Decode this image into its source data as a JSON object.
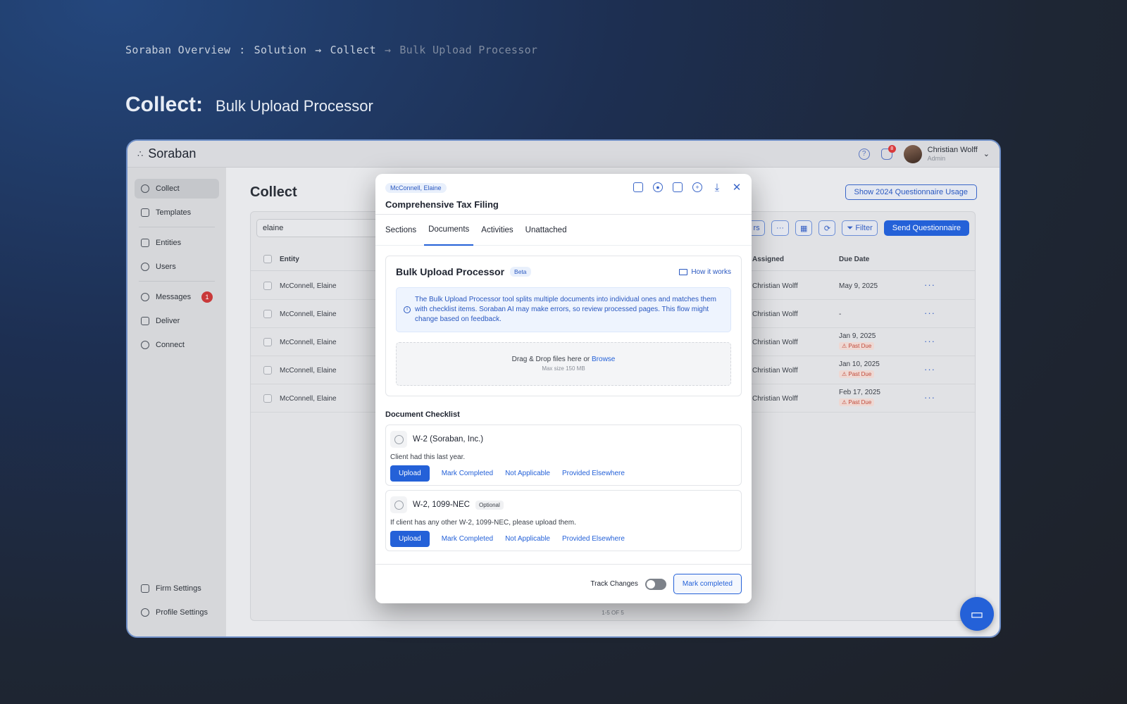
{
  "breadcrumb": {
    "items": [
      "Soraban Overview",
      ":",
      "Solution",
      "→",
      "Collect",
      "→",
      "Bulk Upload Processor"
    ]
  },
  "headline": {
    "section": "Collect:",
    "title": "Bulk Upload Processor"
  },
  "app": {
    "logo": "Soraban",
    "user": {
      "name": "Christian Wolff",
      "role": "Admin",
      "notifications": "8"
    },
    "sidebar": {
      "items": [
        {
          "label": "Collect",
          "icon": "collect-icon"
        },
        {
          "label": "Templates",
          "icon": "file-icon"
        },
        {
          "label": "Entities",
          "icon": "building-icon"
        },
        {
          "label": "Users",
          "icon": "users-icon"
        },
        {
          "label": "Messages",
          "icon": "chat-icon",
          "badge": "1"
        },
        {
          "label": "Deliver",
          "icon": "deliver-icon"
        },
        {
          "label": "Connect",
          "icon": "link-icon"
        }
      ],
      "bottom": [
        {
          "label": "Firm Settings",
          "icon": "building-icon"
        },
        {
          "label": "Profile Settings",
          "icon": "profile-gear-icon"
        }
      ]
    },
    "main": {
      "title": "Collect",
      "questionnaire_usage_btn": "Show 2024 Questionnaire Usage",
      "search_value": "elaine",
      "toolbar": {
        "partial": "rs",
        "more": "···",
        "filter": "Filter",
        "send": "Send Questionnaire"
      },
      "columns": [
        "Entity",
        "Assigned",
        "Due Date"
      ],
      "rows": [
        {
          "entity": "McConnell, Elaine",
          "assigned": "Christian Wolff",
          "due": "May 9, 2025",
          "past_due": ""
        },
        {
          "entity": "McConnell, Elaine",
          "assigned": "Christian Wolff",
          "due": "-",
          "past_due": ""
        },
        {
          "entity": "McConnell, Elaine",
          "assigned": "Christian Wolff",
          "due": "Jan 9, 2025",
          "past_due": "⚠ Past Due"
        },
        {
          "entity": "McConnell, Elaine",
          "assigned": "Christian Wolff",
          "due": "Jan 10, 2025",
          "past_due": "⚠ Past Due"
        },
        {
          "entity": "McConnell, Elaine",
          "assigned": "Christian Wolff",
          "due": "Feb 17, 2025",
          "past_due": "⚠ Past Due"
        }
      ],
      "pager": "1-5 OF 5"
    }
  },
  "modal": {
    "client_chip": "McConnell, Elaine",
    "title": "Comprehensive Tax Filing",
    "tabs": [
      "Sections",
      "Documents",
      "Activities",
      "Unattached"
    ],
    "active_tab": "Documents",
    "bulk": {
      "title": "Bulk Upload Processor",
      "beta": "Beta",
      "how": "How it works",
      "info": "The Bulk Upload Processor tool splits multiple documents into individual ones and matches them with checklist items. Soraban AI may make errors, so review processed pages. This flow might change based on feedback.",
      "drop_text": "Drag & Drop files here or",
      "browse": "Browse",
      "max_size": "Max size 150 MB"
    },
    "checklist_title": "Document Checklist",
    "items": [
      {
        "name": "W-2 (Soraban, Inc.)",
        "optional": "",
        "desc": "Client had this last year."
      },
      {
        "name": "W-2, 1099-NEC",
        "optional": "Optional",
        "desc": "If client has any other W-2, 1099-NEC, please upload them."
      }
    ],
    "actions": {
      "upload": "Upload",
      "mark": "Mark Completed",
      "na": "Not Applicable",
      "elsewhere": "Provided Elsewhere"
    },
    "footer": {
      "track": "Track Changes",
      "track_on": false,
      "complete": "Mark completed"
    }
  },
  "colors": {
    "accent": "#2461d8",
    "past_due": "#c24a3a",
    "bg_dark": "#1e2634"
  }
}
